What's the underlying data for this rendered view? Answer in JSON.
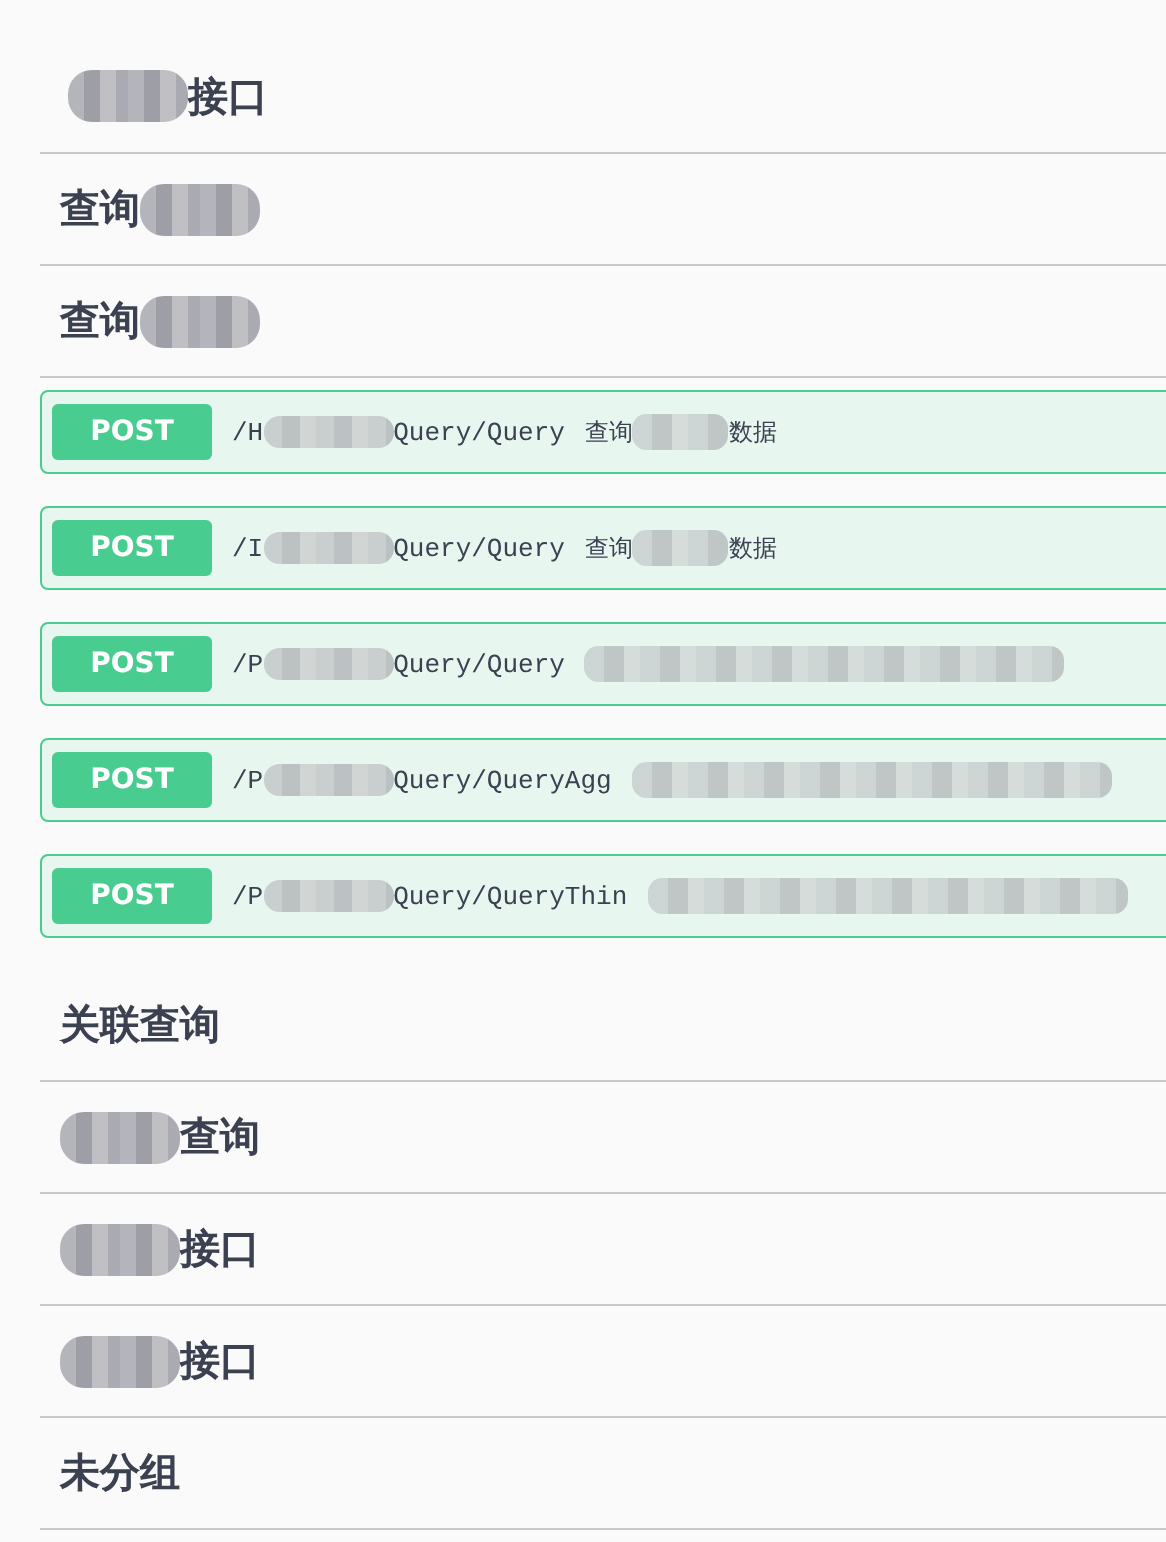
{
  "sections": [
    {
      "title": [
        {
          "kind": "redacted"
        },
        {
          "kind": "text",
          "text": "接口"
        }
      ]
    },
    {
      "title": [
        {
          "kind": "text",
          "text": "查询"
        },
        {
          "kind": "redacted"
        }
      ]
    },
    {
      "title": [
        {
          "kind": "text",
          "text": "查询"
        },
        {
          "kind": "redacted"
        }
      ],
      "operations": [
        {
          "method": "POST",
          "path": [
            {
              "kind": "text",
              "text": "/H"
            },
            {
              "kind": "redacted"
            },
            {
              "kind": "text",
              "text": "Query/Query"
            }
          ],
          "summary": [
            {
              "kind": "text",
              "text": "查询"
            },
            {
              "kind": "redacted"
            },
            {
              "kind": "text",
              "text": "数据"
            }
          ]
        },
        {
          "method": "POST",
          "path": [
            {
              "kind": "text",
              "text": "/I"
            },
            {
              "kind": "redacted"
            },
            {
              "kind": "text",
              "text": "Query/Query"
            }
          ],
          "summary": [
            {
              "kind": "text",
              "text": "查询"
            },
            {
              "kind": "redacted"
            },
            {
              "kind": "text",
              "text": "数据"
            }
          ]
        },
        {
          "method": "POST",
          "path": [
            {
              "kind": "text",
              "text": "/P"
            },
            {
              "kind": "redacted"
            },
            {
              "kind": "text",
              "text": "Query/Query"
            }
          ],
          "summary": [
            {
              "kind": "redacted"
            }
          ]
        },
        {
          "method": "POST",
          "path": [
            {
              "kind": "text",
              "text": "/P"
            },
            {
              "kind": "redacted"
            },
            {
              "kind": "text",
              "text": "Query/QueryAgg"
            }
          ],
          "summary": [
            {
              "kind": "redacted"
            }
          ]
        },
        {
          "method": "POST",
          "path": [
            {
              "kind": "text",
              "text": "/P"
            },
            {
              "kind": "redacted"
            },
            {
              "kind": "text",
              "text": "Query/QueryThin"
            }
          ],
          "summary": [
            {
              "kind": "redacted"
            }
          ]
        }
      ]
    },
    {
      "title": [
        {
          "kind": "text",
          "text": "关联查询"
        }
      ]
    },
    {
      "title": [
        {
          "kind": "redacted"
        },
        {
          "kind": "text",
          "text": "查询"
        }
      ]
    },
    {
      "title": [
        {
          "kind": "redacted"
        },
        {
          "kind": "text",
          "text": "接口"
        }
      ]
    },
    {
      "title": [
        {
          "kind": "redacted"
        },
        {
          "kind": "text",
          "text": "接口"
        }
      ]
    },
    {
      "title": [
        {
          "kind": "text",
          "text": "未分组"
        }
      ]
    }
  ]
}
